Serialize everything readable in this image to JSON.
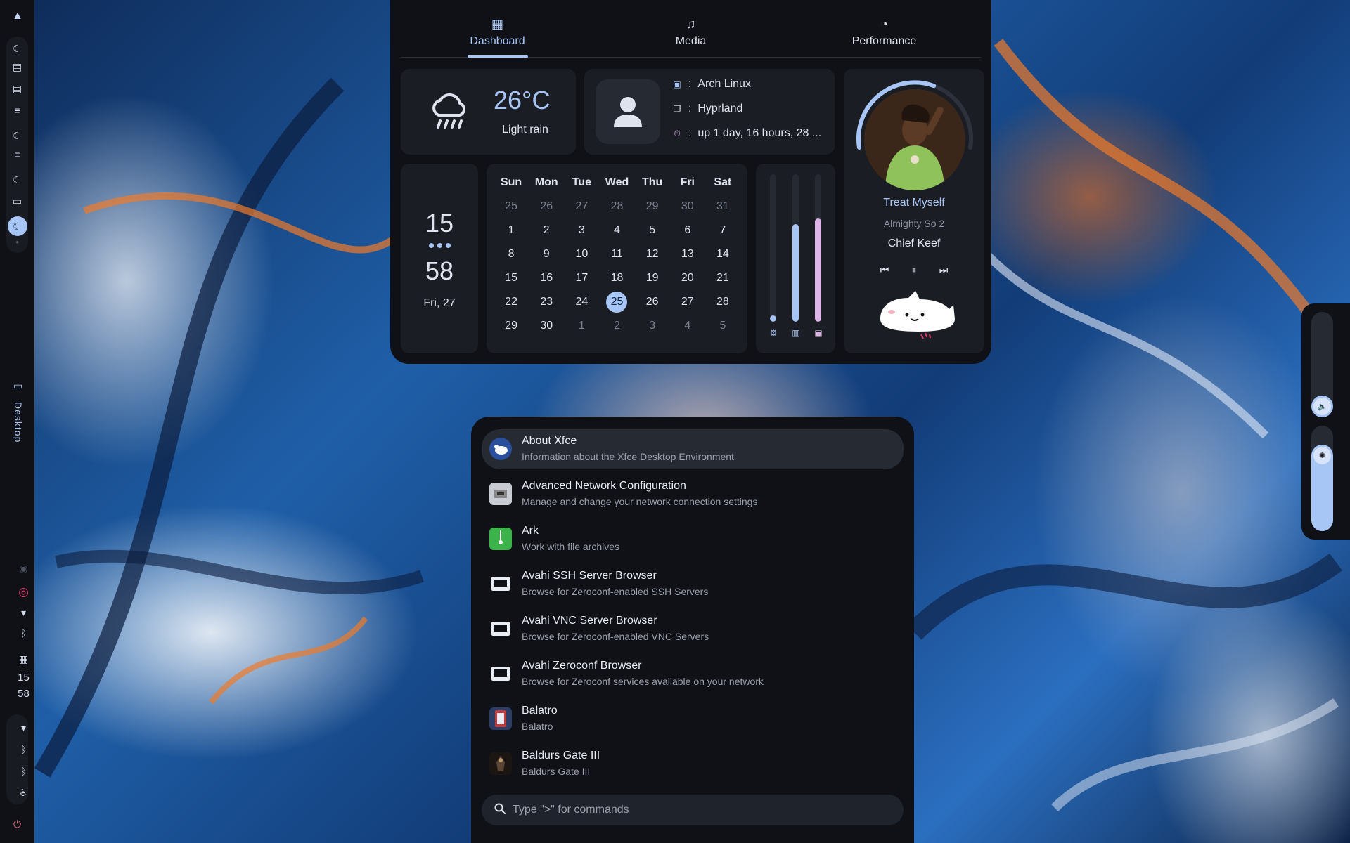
{
  "tabs": [
    {
      "label": "Dashboard",
      "icon": "dashboard-icon"
    },
    {
      "label": "Media",
      "icon": "queue-music-icon"
    },
    {
      "label": "Performance",
      "icon": "speedometer-icon"
    }
  ],
  "weather": {
    "temp": "26°C",
    "desc": "Light rain"
  },
  "system": {
    "os": "Arch Linux",
    "wm": "Hyprland",
    "uptime": "up 1 day, 16 hours, 28 ...",
    "sep": ":"
  },
  "clock": {
    "hours": "15",
    "minutes": "58",
    "date": "Fri, 27"
  },
  "calendar": {
    "weekdays": [
      "Sun",
      "Mon",
      "Tue",
      "Wed",
      "Thu",
      "Fri",
      "Sat"
    ],
    "weeks": [
      [
        "25",
        "26",
        "27",
        "28",
        "29",
        "30",
        "31"
      ],
      [
        "1",
        "2",
        "3",
        "4",
        "5",
        "6",
        "7"
      ],
      [
        "8",
        "9",
        "10",
        "11",
        "12",
        "13",
        "14"
      ],
      [
        "15",
        "16",
        "17",
        "18",
        "19",
        "20",
        "21"
      ],
      [
        "22",
        "23",
        "24",
        "25",
        "26",
        "27",
        "28"
      ],
      [
        "29",
        "30",
        "1",
        "2",
        "3",
        "4",
        "5"
      ]
    ]
  },
  "resources": {
    "cpu": 0.04,
    "memory": 0.66,
    "storage": 0.7
  },
  "media": {
    "title": "Treat Myself",
    "album": "Almighty So 2",
    "artist": "Chief Keef",
    "progress": 0.6
  },
  "sidebar": {
    "clock_h": "15",
    "clock_m": "58",
    "workspace_label": "Desktop"
  },
  "sliders": {
    "volume": 0.14,
    "brightness": 0.82
  },
  "apps": [
    {
      "name": "About Xfce",
      "desc": "Information about the Xfce Desktop Environment"
    },
    {
      "name": "Advanced Network Configuration",
      "desc": "Manage and change your network connection settings"
    },
    {
      "name": "Ark",
      "desc": "Work with file archives"
    },
    {
      "name": "Avahi SSH Server Browser",
      "desc": "Browse for Zeroconf-enabled SSH Servers"
    },
    {
      "name": "Avahi VNC Server Browser",
      "desc": "Browse for Zeroconf-enabled VNC Servers"
    },
    {
      "name": "Avahi Zeroconf Browser",
      "desc": "Browse for Zeroconf services available on your network"
    },
    {
      "name": "Balatro",
      "desc": "Balatro"
    },
    {
      "name": "Baldurs Gate III",
      "desc": "Baldurs Gate III"
    }
  ],
  "search": {
    "placeholder": "Type \">\" for commands"
  },
  "colors": {
    "accent": "#a8c6f5",
    "surface": "#1a1d24",
    "bg": "#0f1116"
  }
}
